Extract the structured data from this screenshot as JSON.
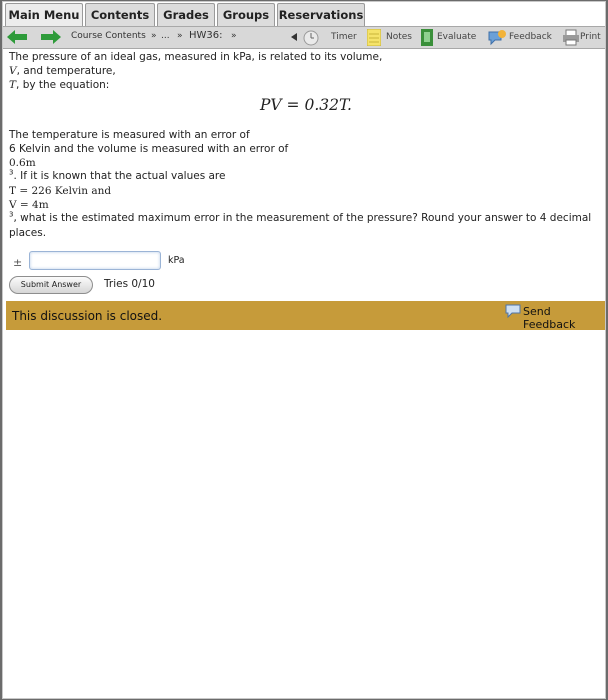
{
  "menu": {
    "tabs": [
      "Main Menu",
      "Contents",
      "Grades",
      "Groups",
      "Reservations"
    ]
  },
  "nav": {
    "breadcrumb": {
      "course": "Course Contents",
      "sep1": "»",
      "ellipsis": "...",
      "sep2": "»",
      "current": "HW36:",
      "sep3": "»"
    },
    "tools": {
      "timer": "Timer",
      "notes": "Notes",
      "evaluate": "Evaluate",
      "feedback": "Feedback",
      "print": "Print"
    }
  },
  "problem": {
    "intro1": "The pressure of an ideal gas, measured in kPa, is related to its volume,",
    "var_v": "V",
    "intro2": ", and temperature,",
    "var_t": "T",
    "intro3": ", by the equation:",
    "equation": "PV = 0.32T.",
    "err1": "The temperature is measured with an error of",
    "err2": "6 Kelvin and the volume is measured with an error of",
    "err3": "0.6m",
    "sup3a": "3",
    "known": ". If it is known that the actual values are",
    "t_val": "T = 226 Kelvin and",
    "v_val": "V = 4m",
    "sup3b": "3",
    "question": ", what is the estimated maximum error in the measurement of the pressure? Round your answer to 4 decimal",
    "question2": "places."
  },
  "answer": {
    "pm": "±",
    "value": "",
    "unit": "kPa",
    "submit": "Submit Answer",
    "tries": "Tries 0/10"
  },
  "discussion": {
    "status": "This discussion is closed.",
    "send_feedback": "Send Feedback"
  },
  "colors": {
    "discussion_bar": "#c69b3a",
    "nav_bg": "#d8d8d8",
    "arrow_green": "#2e9b3a"
  }
}
